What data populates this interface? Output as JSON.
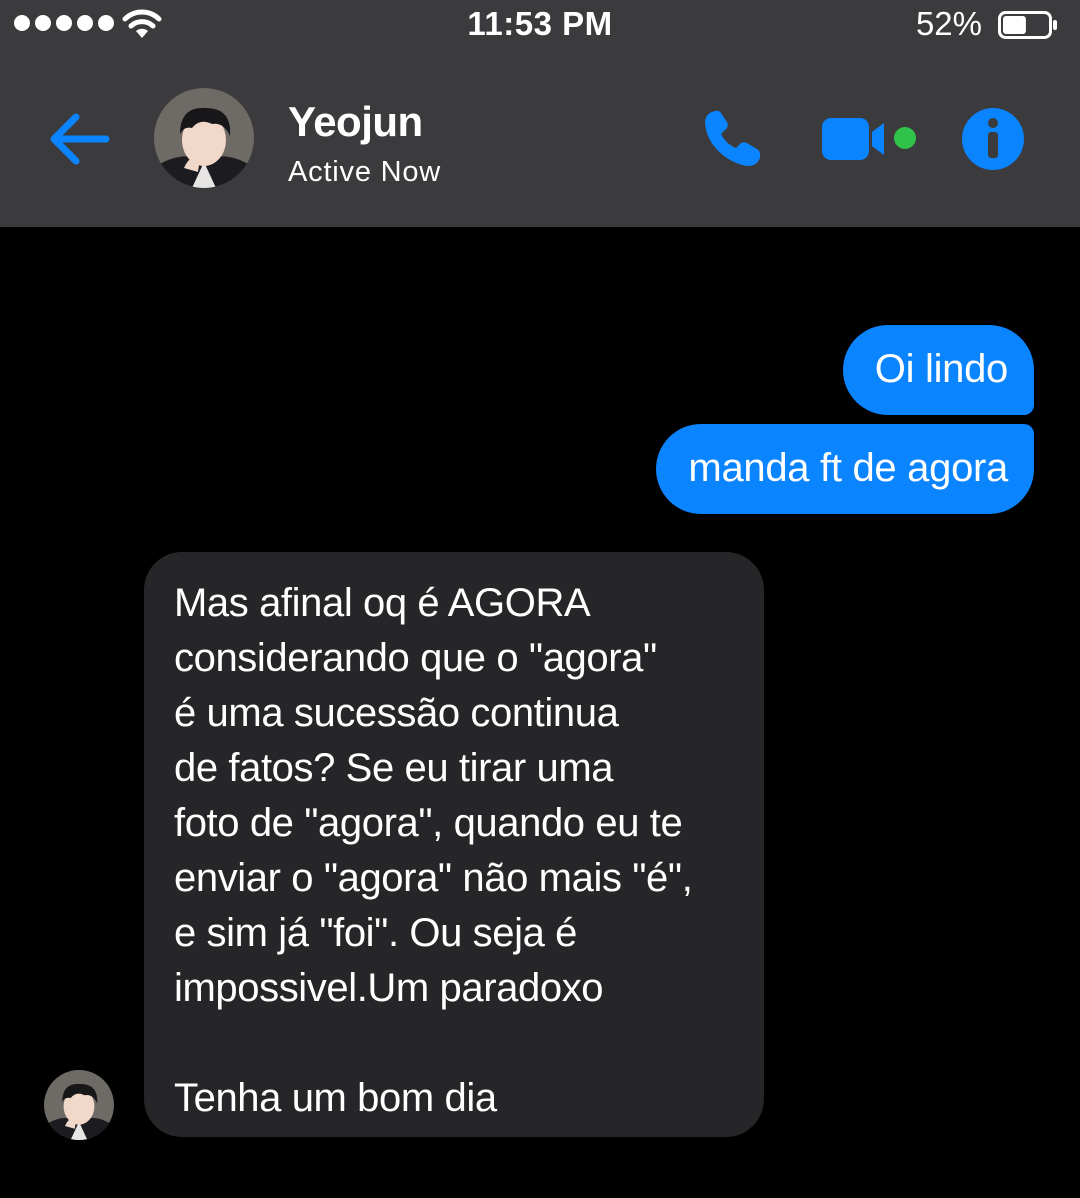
{
  "status_bar": {
    "time": "11:53 PM",
    "battery_percent": "52%",
    "battery_level": 0.52,
    "signal_icon": "signal-dots-icon",
    "wifi_icon": "wifi-icon"
  },
  "header": {
    "contact_name": "Yeojun",
    "contact_status": "Active Now",
    "back_icon": "arrow-left-icon",
    "call_icon": "phone-icon",
    "video_icon": "video-camera-icon",
    "info_icon": "info-icon",
    "online_indicator_color": "#31c24c"
  },
  "colors": {
    "accent": "#0a84ff",
    "header_bg": "#3b3b3d",
    "incoming_bubble": "#262629",
    "background": "#000000"
  },
  "messages": [
    {
      "direction": "outgoing",
      "text": "Oi lindo"
    },
    {
      "direction": "outgoing",
      "text": "manda ft de agora"
    },
    {
      "direction": "incoming",
      "lines": [
        "Mas afinal oq é AGORA",
        "considerando que o \"agora\"",
        "é uma sucessão continua",
        "de fatos? Se eu tirar uma",
        "foto de \"agora\", quando eu te",
        "enviar o \"agora\" não mais \"é\",",
        "e sim já \"foi\". Ou seja é",
        "impossivel.Um paradoxo",
        "",
        "Tenha um bom dia"
      ]
    }
  ]
}
